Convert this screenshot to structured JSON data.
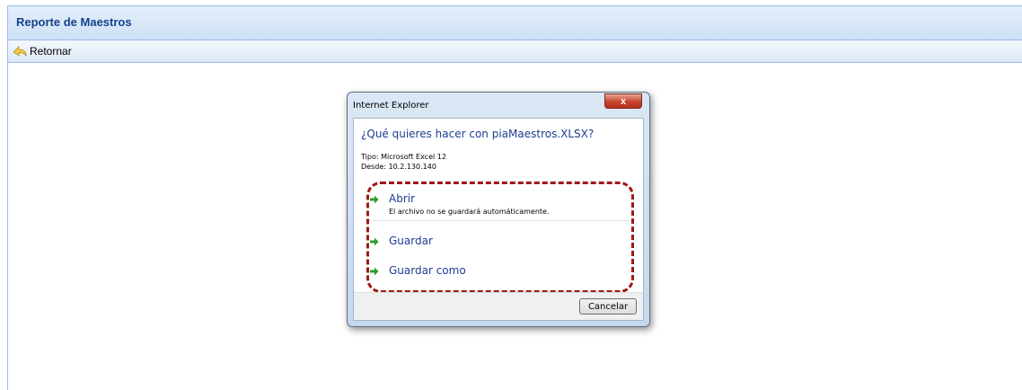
{
  "panel": {
    "title": "Reporte de Maestros"
  },
  "toolbar": {
    "retornar_label": "Retornar",
    "retornar_icon": "return-arrow-icon"
  },
  "dialog": {
    "title": "Internet Explorer",
    "close_label": "x",
    "question": "¿Qué quieres hacer con piaMaestros.XLSX?",
    "type_line": "Tipo: Microsoft Excel 12",
    "from_line": "Desde: 10.2.130.140",
    "options": [
      {
        "label": "Abrir",
        "description": "El archivo no se guardará automáticamente."
      },
      {
        "label": "Guardar"
      },
      {
        "label": "Guardar como"
      }
    ],
    "cancel_label": "Cancelar"
  },
  "colors": {
    "header_text": "#15428b",
    "link_blue": "#1e3d91",
    "arrow_green": "#2e9b2e",
    "highlight_red": "#a01818"
  }
}
